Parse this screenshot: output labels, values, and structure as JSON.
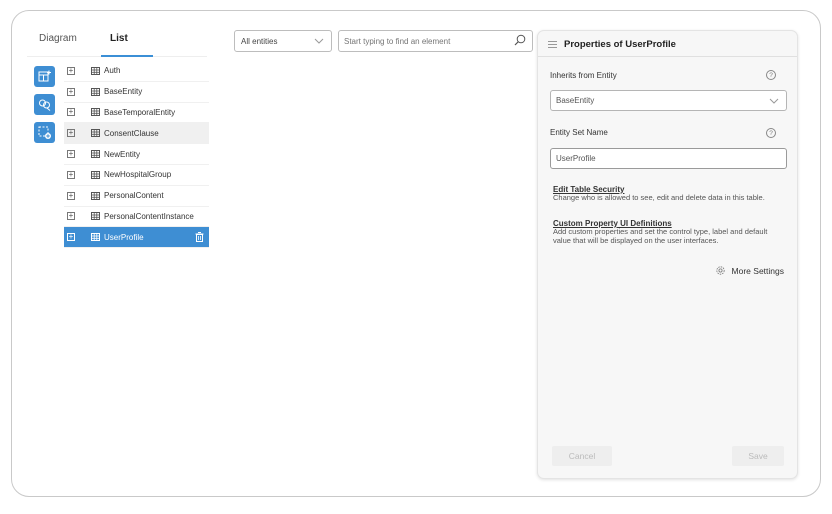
{
  "tabs": {
    "diagram": "Diagram",
    "list": "List"
  },
  "tools": [
    {
      "icon": "add-table-icon"
    },
    {
      "icon": "relation-icon"
    },
    {
      "icon": "add-selection-icon"
    }
  ],
  "tree": {
    "items": [
      {
        "label": "Auth",
        "state": ""
      },
      {
        "label": "BaseEntity",
        "state": ""
      },
      {
        "label": "BaseTemporalEntity",
        "state": ""
      },
      {
        "label": "ConsentClause",
        "state": "hover"
      },
      {
        "label": "NewEntity",
        "state": ""
      },
      {
        "label": "NewHospitalGroup",
        "state": ""
      },
      {
        "label": "PersonalContent",
        "state": ""
      },
      {
        "label": "PersonalContentInstance",
        "state": ""
      },
      {
        "label": "UserProfile",
        "state": "selected"
      }
    ]
  },
  "filter": {
    "selected": "All entities"
  },
  "search": {
    "placeholder": "Start typing to find an element"
  },
  "panel": {
    "title": "Properties of UserProfile",
    "inherits_label": "Inherits from Entity",
    "inherits_value": "BaseEntity",
    "entity_set_label": "Entity Set Name",
    "entity_set_value": "UserProfile",
    "help_glyph": "?",
    "links": [
      {
        "title": "Edit Table Security",
        "desc": "Change who is allowed to see, edit and delete data in this table."
      },
      {
        "title": "Custom Property UI Definitions",
        "desc": "Add custom properties and set the control type, label and default value that will be displayed on the user interfaces."
      }
    ],
    "more_settings": "More Settings",
    "cancel": "Cancel",
    "save": "Save"
  },
  "colors": {
    "accent": "#3e8ed3",
    "selected_row": "#3e8ed3",
    "hover_row": "#f0f0f0"
  }
}
